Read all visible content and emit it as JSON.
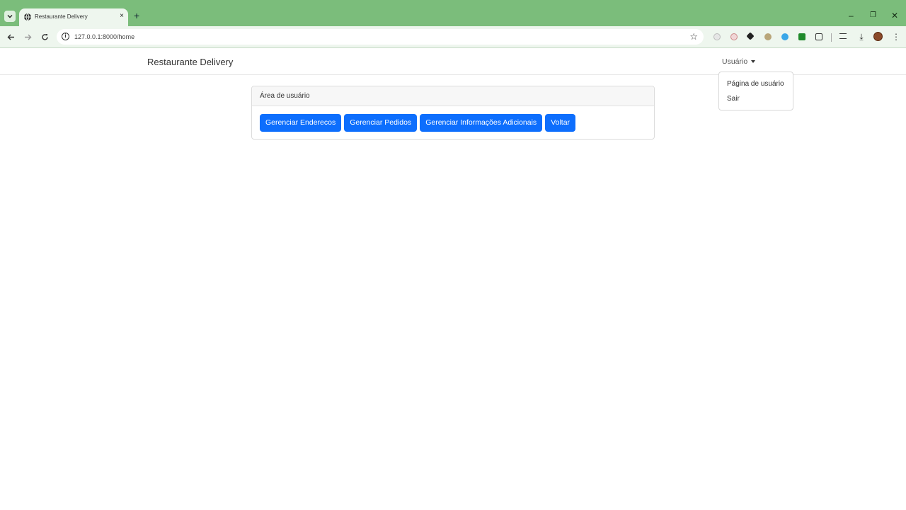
{
  "browser": {
    "tab_title": "Restaurante Delivery",
    "tab_close": "×",
    "new_tab": "+",
    "url": "127.0.0.1:8000/home",
    "window_controls": {
      "minimize": "–",
      "restore": "❐",
      "close": "✕"
    },
    "colors": {
      "frame": "#7bbd7b",
      "toolbar": "#eef6ee"
    }
  },
  "navbar": {
    "brand": "Restaurante Delivery",
    "user_menu_label": "Usuário",
    "dropdown_items": [
      "Página de usuário",
      "Sair"
    ]
  },
  "card": {
    "header": "Área de usuário",
    "buttons": [
      "Gerenciar Enderecos",
      "Gerenciar Pedidos",
      "Gerenciar Informações Adicionais",
      "Voltar"
    ]
  },
  "colors": {
    "primary_button": "#0d6efd"
  }
}
